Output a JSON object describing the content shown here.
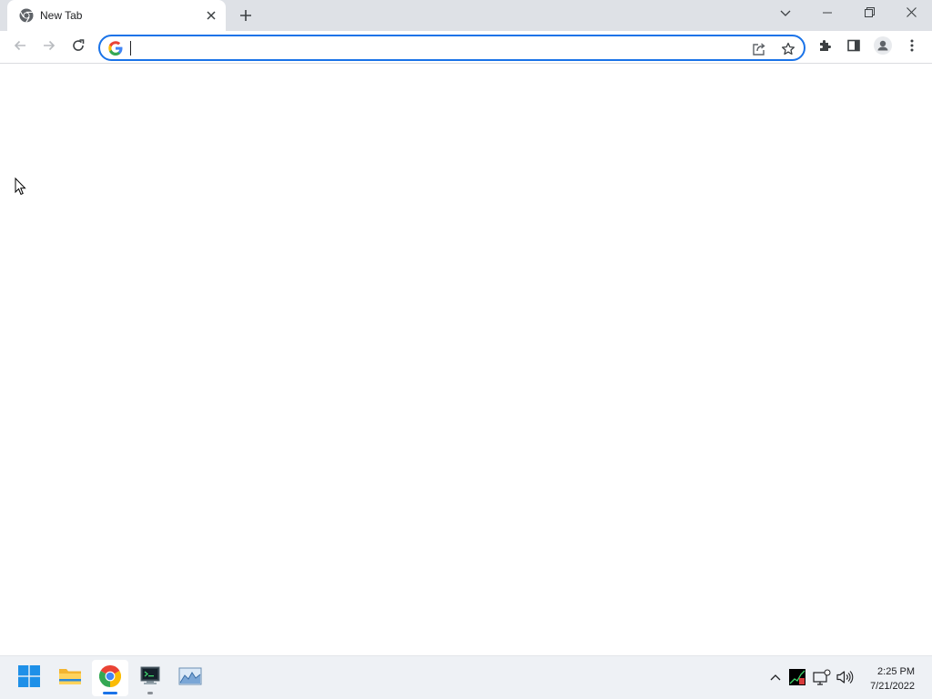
{
  "window": {
    "tab": {
      "title": "New Tab",
      "favicon": "chrome-icon"
    },
    "controls": {
      "tab_search": "chevron-down-icon",
      "minimize": "minimize-icon",
      "restore": "restore-icon",
      "close": "close-icon"
    }
  },
  "toolbar": {
    "back": "back-arrow-icon",
    "forward": "forward-arrow-icon",
    "reload": "reload-icon",
    "omnibox": {
      "value": "",
      "placeholder": "",
      "search_engine_icon": "google-g-icon",
      "share_icon": "share-icon",
      "bookmark_icon": "star-icon"
    },
    "extensions": "puzzle-icon",
    "side_panel": "side-panel-icon",
    "profile": "profile-icon",
    "menu": "kebab-menu-icon"
  },
  "taskbar": {
    "apps": [
      {
        "name": "start",
        "icon": "windows-start-icon"
      },
      {
        "name": "file-explorer",
        "icon": "folder-icon"
      },
      {
        "name": "chrome",
        "icon": "chrome-icon",
        "active": true
      },
      {
        "name": "terminal-app",
        "icon": "terminal-app-icon"
      },
      {
        "name": "image-viewer",
        "icon": "image-viewer-icon"
      }
    ],
    "tray": {
      "overflow": "chevron-up-icon",
      "app_icon": "task-manager-icon",
      "network": "network-icon",
      "volume": "speaker-icon"
    },
    "clock": {
      "time": "2:25 PM",
      "date": "7/21/2022"
    }
  },
  "colors": {
    "accent": "#1a73e8",
    "tabstrip": "#dee1e6",
    "taskbar": "#eef1f5"
  }
}
